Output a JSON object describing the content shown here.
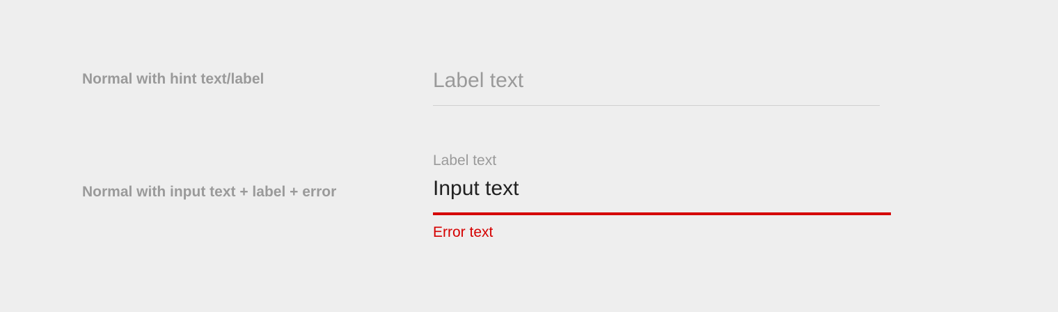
{
  "rows": [
    {
      "description": "Normal with hint text/label",
      "hint": "Label text"
    },
    {
      "description": "Normal with input text + label + error",
      "label": "Label text",
      "value": "Input text",
      "error": "Error text"
    }
  ],
  "colors": {
    "background": "#eeeeee",
    "muted_text": "#9a9a9a",
    "input_text": "#212121",
    "divider": "#cfcfcf",
    "error": "#d50000"
  }
}
